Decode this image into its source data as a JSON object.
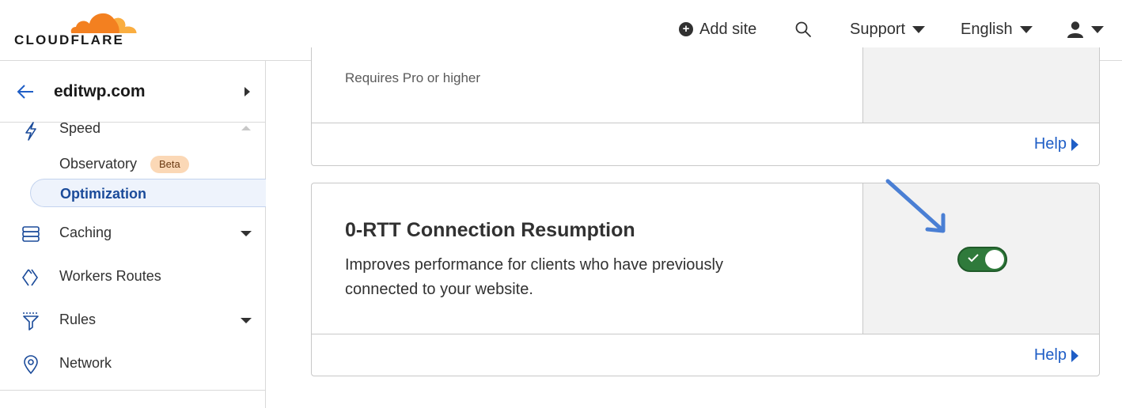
{
  "header": {
    "logo_text": "CLOUDFLARE",
    "add_site_label": "Add site",
    "support_label": "Support",
    "language_label": "English"
  },
  "sidebar": {
    "site_name": "editwp.com",
    "items": [
      {
        "label": "Speed",
        "icon": "lightning-icon",
        "expanded": true
      },
      {
        "label": "Caching",
        "icon": "caching-icon"
      },
      {
        "label": "Workers Routes",
        "icon": "workers-icon"
      },
      {
        "label": "Rules",
        "icon": "rules-icon"
      },
      {
        "label": "Network",
        "icon": "location-pin-icon"
      }
    ],
    "sub_items": [
      {
        "label": "Observatory",
        "badge": "Beta"
      },
      {
        "label": "Optimization",
        "active": true
      }
    ]
  },
  "cards": [
    {
      "note": "Requires Pro or higher",
      "help_label": "Help"
    },
    {
      "title": "0-RTT Connection Resumption",
      "description": "Improves performance for clients who have previously connected to your website.",
      "toggle_on": true,
      "help_label": "Help"
    }
  ],
  "colors": {
    "brand_orange": "#f38020",
    "link_blue": "#1f5ec6",
    "toggle_green": "#2f7a3b",
    "annotation_arrow": "#4a7fd4"
  }
}
